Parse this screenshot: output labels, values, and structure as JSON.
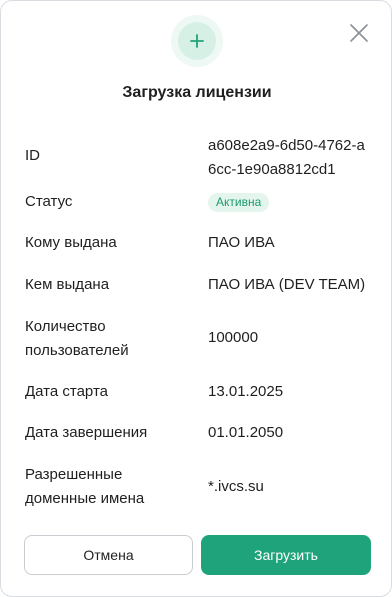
{
  "dialog": {
    "title": "Загрузка лицензии",
    "icons": {
      "header": "plus-icon",
      "close": "close-icon"
    },
    "accent_color": "#1fa37a",
    "rows": {
      "id": {
        "label": "ID",
        "value": "a608e2a9-6d50-4762-a6cc-1e90a8812cd1"
      },
      "status": {
        "label": "Статус",
        "value": "Активна"
      },
      "issued_to": {
        "label": "Кому выдана",
        "value": "ПАО ИВА"
      },
      "issued_by": {
        "label": "Кем выдана",
        "value": "ПАО ИВА (DEV TEAM)"
      },
      "users": {
        "label": "Количество пользователей",
        "value": "100000"
      },
      "start": {
        "label": "Дата старта",
        "value": "13.01.2025"
      },
      "end": {
        "label": "Дата завершения",
        "value": "01.01.2050"
      },
      "domains": {
        "label": "Разрешенные доменные имена",
        "value": "*.ivcs.su"
      }
    },
    "buttons": {
      "cancel": "Отмена",
      "upload": "Загрузить"
    }
  }
}
